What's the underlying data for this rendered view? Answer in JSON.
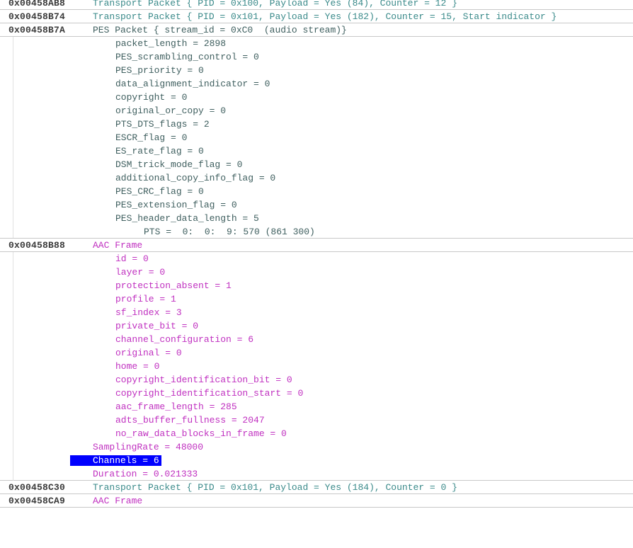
{
  "entries": {
    "e0": {
      "addr": "0x00458AB8",
      "text": "Transport Packet { PID = 0x100, Payload = Yes (84), Counter = 12 }"
    },
    "e1": {
      "addr": "0x00458B74",
      "text": "Transport Packet { PID = 0x101, Payload = Yes (182), Counter = 15, Start indicator }"
    },
    "e2": {
      "addr": "0x00458B7A",
      "text": "PES Packet { stream_id = 0xC0  (audio stream)}"
    },
    "e3": {
      "addr": "0x00458B88",
      "text": "AAC Frame"
    },
    "e4": {
      "addr": "0x00458C30",
      "text": "Transport Packet { PID = 0x101, Payload = Yes (184), Counter = 0 }"
    },
    "e5": {
      "addr": "0x00458CA9",
      "text": "AAC Frame"
    }
  },
  "pes_fields": [
    "packet_length = 2898",
    "PES_scrambling_control = 0",
    "PES_priority = 0",
    "data_alignment_indicator = 0",
    "copyright = 0",
    "original_or_copy = 0",
    "PTS_DTS_flags = 2",
    "ESCR_flag = 0",
    "ES_rate_flag = 0",
    "DSM_trick_mode_flag = 0",
    "additional_copy_info_flag = 0",
    "PES_CRC_flag = 0",
    "PES_extension_flag = 0",
    "PES_header_data_length = 5"
  ],
  "pts": "PTS =  0:  0:  9: 570 (861 300)",
  "aac_fields": [
    "id = 0",
    "layer = 0",
    "protection_absent = 1",
    "profile = 1",
    "sf_index = 3",
    "private_bit = 0",
    "channel_configuration = 6",
    "original = 0",
    "home = 0",
    "copyright_identification_bit = 0",
    "copyright_identification_start = 0",
    "aac_frame_length = 285",
    "adts_buffer_fullness = 2047",
    "no_raw_data_blocks_in_frame = 0"
  ],
  "aac_summary": {
    "sampling_rate": "SamplingRate = 48000",
    "channels": "Channels = 6",
    "duration": "Duration = 0.021333"
  },
  "colors": {
    "transport_text": "#3a8a8a",
    "pes_text": "#3f5f5f",
    "aac_text": "#c030c0",
    "selection_bg": "#0000ff"
  }
}
